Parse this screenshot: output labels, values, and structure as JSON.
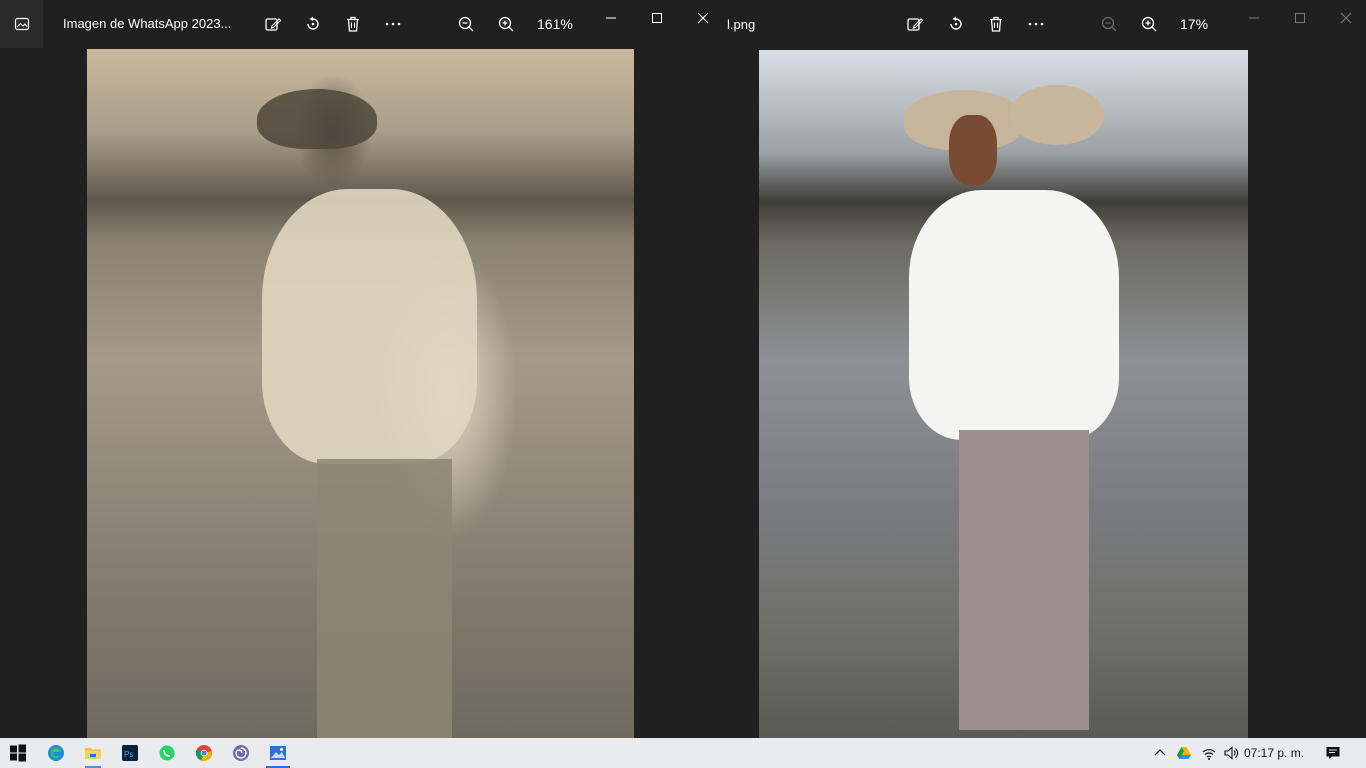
{
  "window_left": {
    "title": "Imagen de WhatsApp 2023...",
    "zoom": "161%",
    "toolbar": {
      "edit_icon": "edit-image-icon",
      "rotate_icon": "rotate-icon",
      "delete_icon": "trash-icon",
      "more_icon": "more-icon",
      "zoom_out_icon": "zoom-out-icon",
      "zoom_in_icon": "zoom-in-icon"
    }
  },
  "window_right": {
    "title": "l.png",
    "zoom": "17%"
  },
  "taskbar": {
    "clock": "07:17 p. m.",
    "apps": [
      "start",
      "edge",
      "file-explorer",
      "photoshop",
      "whatsapp",
      "chrome",
      "app-swirl",
      "photos"
    ]
  },
  "colors": {
    "window_bg": "#202020",
    "taskbar_bg": "#e9ebee",
    "accent": "#2f6fd8"
  }
}
